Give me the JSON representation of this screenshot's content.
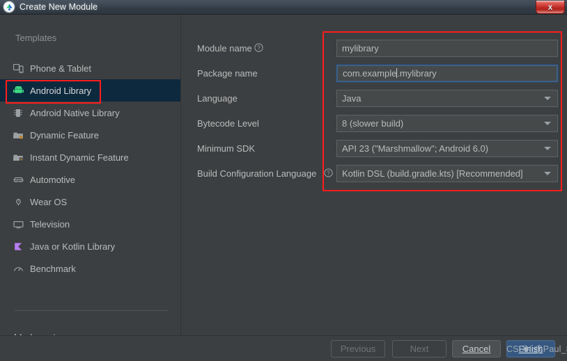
{
  "window": {
    "title": "Create New Module",
    "app_icon": "android-studio-icon",
    "close_label": "x"
  },
  "sidebar": {
    "section_label": "Templates",
    "items": [
      {
        "label": "Phone & Tablet",
        "icon": "phone-tablet-icon",
        "selected": false
      },
      {
        "label": "Android Library",
        "icon": "android-robot-icon",
        "selected": true
      },
      {
        "label": "Android Native Library",
        "icon": "native-chip-icon",
        "selected": false
      },
      {
        "label": "Dynamic Feature",
        "icon": "folder-dynamic-icon",
        "selected": false
      },
      {
        "label": "Instant Dynamic Feature",
        "icon": "folder-instant-icon",
        "selected": false
      },
      {
        "label": "Automotive",
        "icon": "car-icon",
        "selected": false
      },
      {
        "label": "Wear OS",
        "icon": "watch-icon",
        "selected": false
      },
      {
        "label": "Television",
        "icon": "tv-icon",
        "selected": false
      },
      {
        "label": "Java or Kotlin Library",
        "icon": "kotlin-icon",
        "selected": false
      },
      {
        "label": "Benchmark",
        "icon": "gauge-icon",
        "selected": false
      }
    ],
    "import_label": "Import..."
  },
  "form": {
    "fields": [
      {
        "label": "Module name",
        "help": "help-icon",
        "type": "text",
        "value": "mylibrary",
        "focused": false
      },
      {
        "label": "Package name",
        "help": null,
        "type": "text",
        "value_before_caret": "com.example",
        "value_after_caret": ".mylibrary",
        "focused": true
      },
      {
        "label": "Language",
        "help": null,
        "type": "combo",
        "value": "Java",
        "focused": false
      },
      {
        "label": "Bytecode Level",
        "help": null,
        "type": "combo",
        "value": "8 (slower build)",
        "focused": false
      },
      {
        "label": "Minimum SDK",
        "help": null,
        "type": "combo",
        "value": "API 23 (\"Marshmallow\"; Android 6.0)",
        "focused": false
      },
      {
        "label": "Build Configuration Language",
        "help": "help-icon",
        "type": "combo",
        "value": "Kotlin DSL (build.gradle.kts) [Recommended]",
        "focused": false
      }
    ]
  },
  "footer": {
    "previous_label": "Previous",
    "next_label": "Next",
    "cancel_label": "Cancel",
    "cancel_mnemonic": "C",
    "finish_label": "Finish",
    "finish_mnemonic": "F"
  },
  "annotations": {
    "sidebar_highlight_color": "#ff1d1d",
    "form_highlight_color": "#ff1d1d"
  },
  "watermark": {
    "text": "CSDN @Paul_8"
  }
}
